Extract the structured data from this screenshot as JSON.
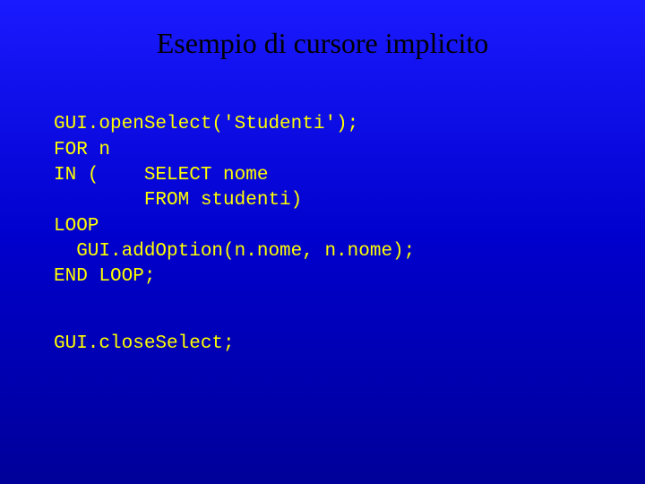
{
  "slide": {
    "title": "Esempio di cursore implicito",
    "code": {
      "line1": "GUI.openSelect('Studenti');",
      "line2": "FOR n",
      "line3": "IN (    SELECT nome",
      "line4": "        FROM studenti)",
      "line5": "LOOP",
      "line6": "  GUI.addOption(n.nome, n.nome);",
      "line7": "END LOOP;",
      "line8": "GUI.closeSelect;"
    }
  }
}
